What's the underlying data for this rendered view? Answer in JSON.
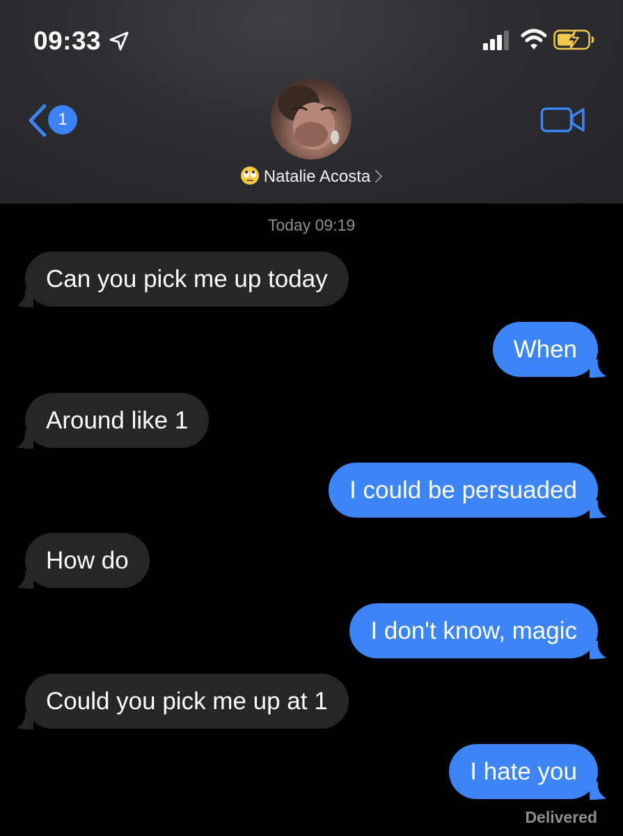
{
  "status_bar": {
    "time": "09:33",
    "location_icon": "location-arrow-icon",
    "signal_icon": "cellular-signal-icon",
    "wifi_icon": "wifi-icon",
    "battery_icon": "battery-charging-icon",
    "battery_color": "#f2c94c"
  },
  "nav": {
    "back_badge_count": "1",
    "contact_name": "Natalie Acosta",
    "contact_emoji": "rolling-eyes-emoji-icon",
    "video_icon": "video-camera-icon",
    "accent_color": "#3d85f6"
  },
  "conversation": {
    "timestamp": "Today 09:19",
    "messages": [
      {
        "direction": "incoming",
        "text": "Can you pick me up today"
      },
      {
        "direction": "outgoing",
        "text": "When"
      },
      {
        "direction": "incoming",
        "text": "Around like 1"
      },
      {
        "direction": "outgoing",
        "text": "I could be persuaded"
      },
      {
        "direction": "incoming",
        "text": "How do"
      },
      {
        "direction": "outgoing",
        "text": "I don't know, magic"
      },
      {
        "direction": "incoming",
        "text": "Could you pick me up at 1"
      },
      {
        "direction": "outgoing",
        "text": "I hate you"
      }
    ],
    "delivery_status": "Delivered"
  }
}
